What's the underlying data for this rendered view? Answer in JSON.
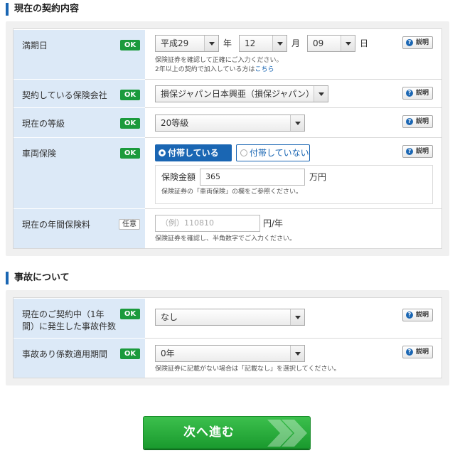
{
  "contract": {
    "title": "現在の契約内容",
    "expiry": {
      "label": "満期日",
      "badge": "OK",
      "era_value": "平成29",
      "era_unit": "年",
      "month_value": "12",
      "month_unit": "月",
      "day_value": "09",
      "day_unit": "日",
      "note_line1": "保険証券を確認して正確にご入力ください。",
      "note_line2_prefix": "2年以上の契約で加入している方は",
      "note_line2_link": "こちら",
      "help_label": "説明"
    },
    "insurer": {
      "label": "契約している保険会社",
      "badge": "OK",
      "value": "損保ジャパン日本興亜（損保ジャパン）",
      "help_label": "説明"
    },
    "grade": {
      "label": "現在の等級",
      "badge": "OK",
      "value": "20等級",
      "help_label": "説明"
    },
    "vehicle": {
      "label": "車両保険",
      "badge": "OK",
      "option_on": "付帯している",
      "option_off": "付帯していない",
      "amount_label": "保険金額",
      "amount_value": "365",
      "amount_unit": "万円",
      "note": "保険証券の「車両保険」の欄をご参照ください。",
      "help_label": "説明"
    },
    "premium": {
      "label": "現在の年間保険料",
      "badge": "任意",
      "placeholder": "（例）110810",
      "unit": "円/年",
      "note": "保険証券を確認し、半角数字でご入力ください。"
    }
  },
  "accident": {
    "title": "事故について",
    "count": {
      "label_line1": "現在のご契約中（1年",
      "label_line2": "間）に発生した事故件数",
      "badge": "OK",
      "value": "なし",
      "help_label": "説明"
    },
    "period": {
      "label": "事故あり係数適用期間",
      "badge": "OK",
      "value": "0年",
      "note": "保険証券に記載がない場合は「記載なし」を選択してください。",
      "help_label": "説明"
    }
  },
  "next_button": {
    "label": "次へ進む"
  }
}
